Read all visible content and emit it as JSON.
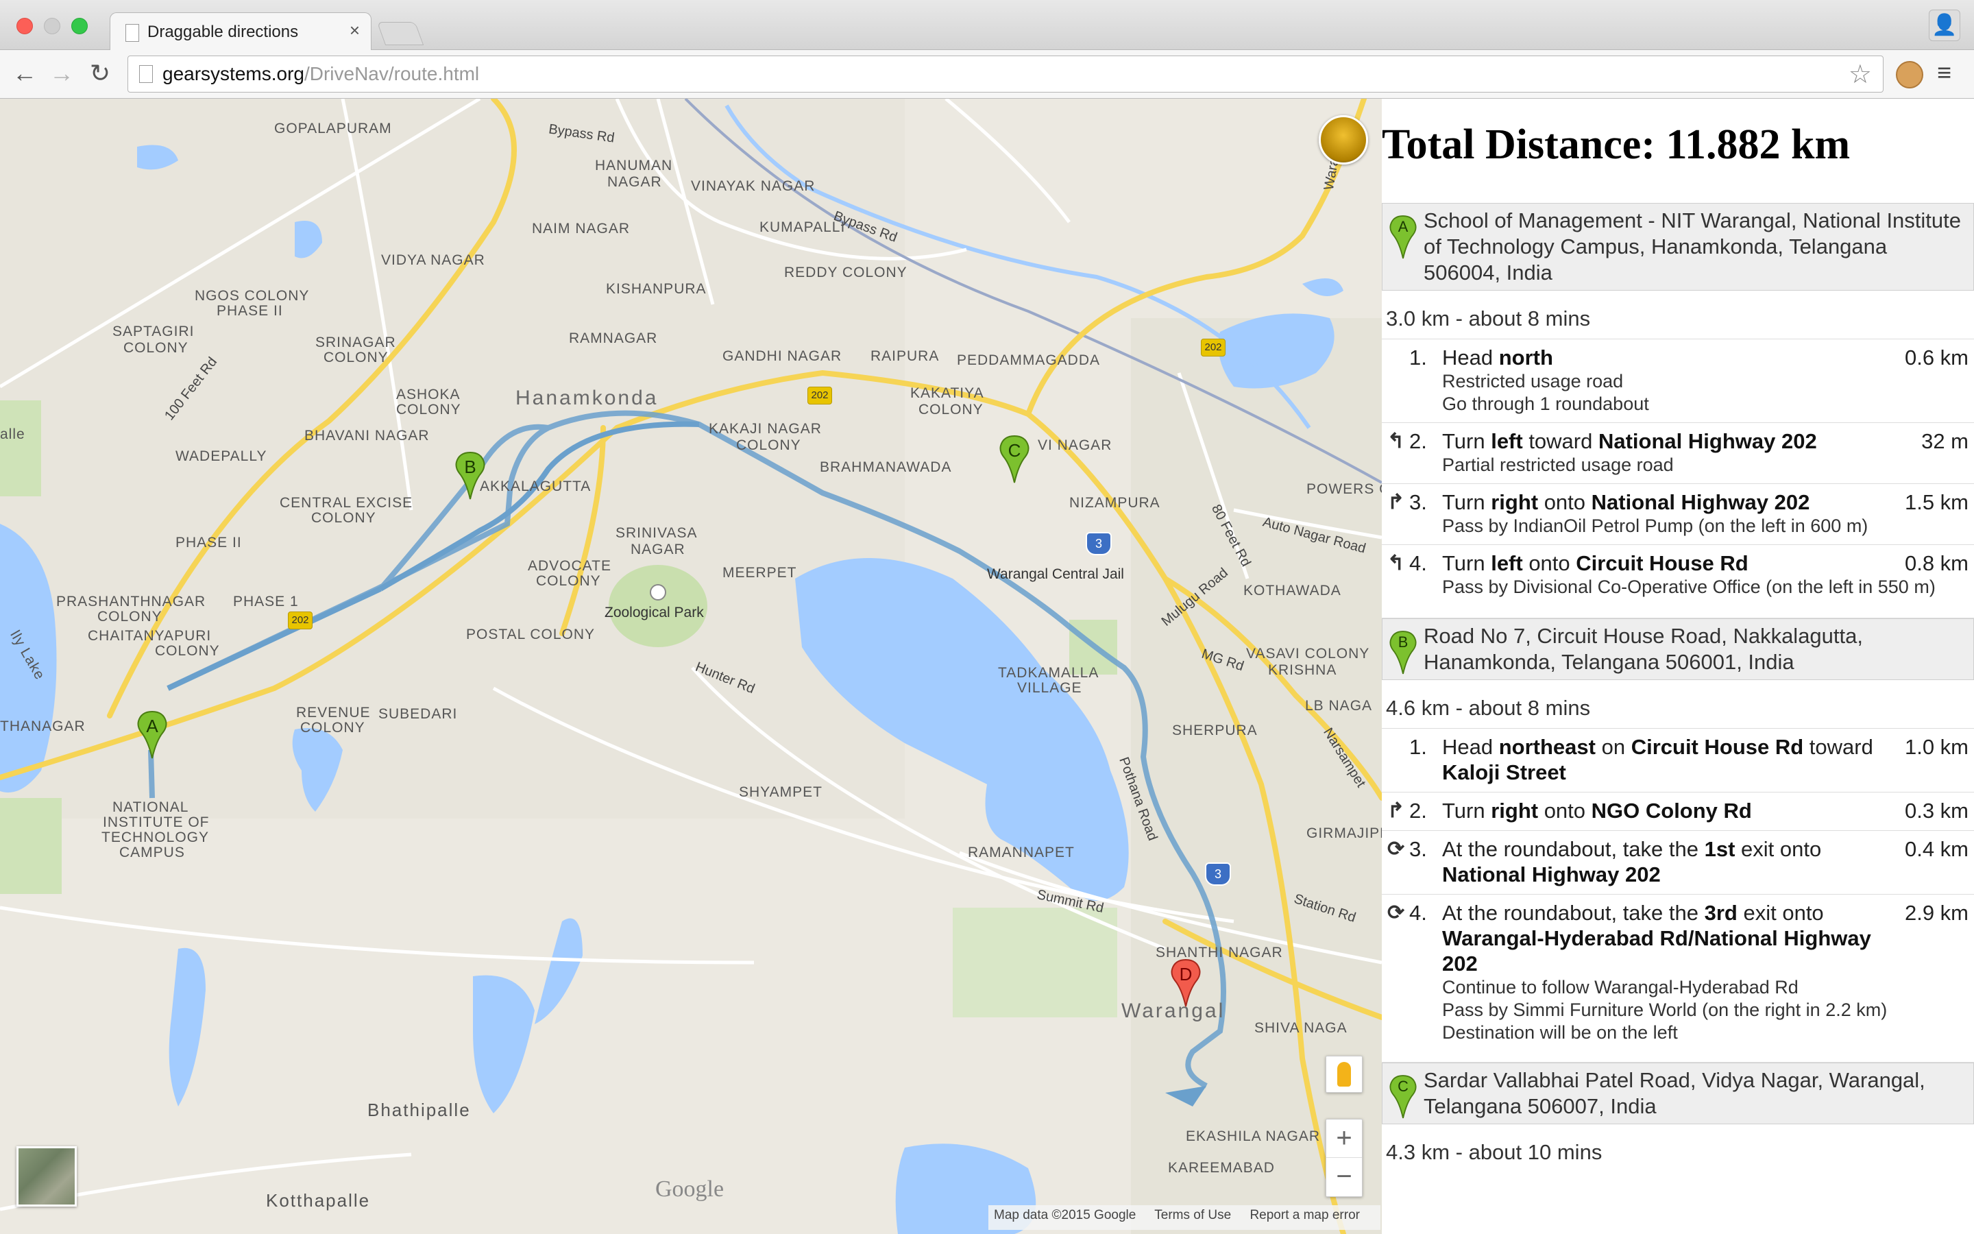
{
  "browser": {
    "tab_title": "Draggable directions",
    "tab_close": "×",
    "url_host": "gearsystems.org",
    "url_path": "/DriveNav/route.html",
    "star": "☆",
    "back": "←",
    "forward": "→",
    "reload": "↻",
    "menu": "≡"
  },
  "map": {
    "labels": {
      "gopalapuram": "GOPALAPURAM",
      "bypass_rd_1": "Bypass Rd",
      "bypass_rd_2": "Bypass Rd",
      "hanuman_nagar_1": "HANUMAN",
      "hanuman_nagar_2": "NAGAR",
      "vinayak_nagar": "VINAYAK NAGAR",
      "naim_nagar": "NAIM NAGAR",
      "kumapalli": "KUMAPALLI",
      "vidya_nagar": "VIDYA NAGAR",
      "reddy_colony": "REDDY COLONY",
      "ngos_colony_1": "NGOS COLONY",
      "ngos_colony_2": "PHASE II",
      "kishanpura": "KISHANPURA",
      "saptagiri_1": "SAPTAGIRI",
      "saptagiri_2": "COLONY",
      "srinagar_1": "SRINAGAR",
      "srinagar_2": "COLONY",
      "ramnagar": "RAMNAGAR",
      "gandhi_nagar": "GANDHI NAGAR",
      "raipura": "RAIPURA",
      "peddammagadda": "PEDDAMMAGADDA",
      "hundred_feet": "100 Feet Rd",
      "ashoka_1": "ASHOKA",
      "ashoka_2": "COLONY",
      "hanamkonda": "Hanamkonda",
      "kakatiya_1": "KAKATIYA",
      "kakatiya_2": "COLONY",
      "bhavani_nagar": "BHAVANI NAGAR",
      "kakaji_1": "KAKAJI NAGAR",
      "kakaji_2": "COLONY",
      "alle": "alle",
      "wadepally": "WADEPALLY",
      "nakkalagutta": "AKKALAGUTTA",
      "brahmanawada": "BRAHMANAWADA",
      "vi_nagar": "VI NAGAR",
      "powers_colony": "POWERS COLO",
      "central_excise_1": "CENTRAL EXCISE",
      "central_excise_2": "COLONY",
      "nizampura": "NIZAMPURA",
      "eighty_feet": "80 Feet Rd",
      "auto_nagar": "Auto Nagar Road",
      "phase2": "PHASE II",
      "srinivasa_1": "SRINIVASA",
      "srinivasa_2": "NAGAR",
      "advocate_1": "ADVOCATE",
      "advocate_2": "COLONY",
      "warangal_central_jail": "Warangal Central Jail",
      "mulugu_road": "Mulugu Road",
      "kothawada": "KOTHAWADA",
      "meerpet": "MEERPET",
      "prashanthnagar_1": "PRASHANTHNAGAR",
      "prashanthnagar_2": "COLONY",
      "phase1": "PHASE 1",
      "zoological_park": "Zoological Park",
      "chaitanyapuri_1": "CHAITANYAPURI",
      "chaitanyapuri_2": "COLONY",
      "postal_colony": "POSTAL COLONY",
      "ly_lake": "lly Lake",
      "mg_rd": "MG Rd",
      "vasavi_colony": "VASAVI COLONY",
      "krishna": "KRISHNA",
      "hunter_rd": "Hunter Rd",
      "tadkamalla_1": "TADKAMALLA",
      "tadkamalla_2": "VILLAGE",
      "thanagar": "THANAGAR",
      "revenue_1": "REVENUE",
      "revenue_2": "COLONY",
      "subedari": "SUBEDARI",
      "lb_nagar": "LB NAGA",
      "sherpura": "SHERPURA",
      "narsampet": "Narsampet",
      "national_1": "NATIONAL",
      "national_2": "INSTITUTE OF",
      "national_3": "TECHNOLOGY",
      "national_4": "CAMPUS",
      "shyampet": "SHYAMPET",
      "pothana_road": "Pothana Road",
      "girmajipet": "GIRMAJIPE",
      "ramannapet": "RAMANNAPET",
      "summit_rd": "Summit Rd",
      "station_rd": "Station Rd",
      "shanthi_nagar": "SHANTHI NAGAR",
      "warangal": "Warangal",
      "shiva_nagar": "SHIVA NAGA",
      "bhathipalle": "Bhathipalle",
      "ekashila_nagar": "EKASHILA NAGAR",
      "kareemabad": "KAREEMABAD",
      "kotthapalle": "Kotthapalle",
      "warangal_rd": "Warangal"
    },
    "shields": {
      "nh202_a": "202",
      "nh202_b": "202",
      "nh202_c": "202",
      "nh3_a": "3",
      "nh3_b": "3"
    },
    "markers": {
      "a": "A",
      "b": "B",
      "c": "C",
      "d": "D"
    },
    "google_logo": "Google",
    "zoom_in": "+",
    "zoom_out": "−",
    "attribution": {
      "map_data": "Map data ©2015 Google",
      "terms": "Terms of Use",
      "report": "Report a map error"
    }
  },
  "directions": {
    "total": "Total Distance: 11.882 km",
    "waypoints": [
      {
        "letter": "A",
        "address": "School of Management - NIT Warangal, National Institute of Technology Campus, Hanamkonda, Telangana 506004, India"
      },
      {
        "letter": "B",
        "address": "Road No 7, Circuit House Road, Nakkalagutta, Hanamkonda, Telangana 506001, India"
      },
      {
        "letter": "C",
        "address": "Sardar Vallabhai Patel Road, Vidya Nagar, Warangal, Telangana 506007, India"
      }
    ],
    "legs": [
      {
        "summary": "3.0 km - about 8 mins",
        "steps": [
          {
            "num": "1.",
            "icon": "",
            "pre": "Head ",
            "b1": "north",
            "mid": "",
            "b2": "",
            "post": "",
            "dist": "0.6 km",
            "notes": [
              "Restricted usage road",
              "Go through 1 roundabout"
            ]
          },
          {
            "num": "2.",
            "icon": "↰",
            "pre": "Turn ",
            "b1": "left",
            "mid": " toward ",
            "b2": "National Highway 202",
            "post": "",
            "dist": "32 m",
            "notes": [
              "Partial restricted usage road"
            ]
          },
          {
            "num": "3.",
            "icon": "↱",
            "pre": "Turn ",
            "b1": "right",
            "mid": " onto ",
            "b2": "National Highway 202",
            "post": "",
            "dist": "1.5 km",
            "notes": [
              "Pass by IndianOil Petrol Pump (on the left in 600 m)"
            ]
          },
          {
            "num": "4.",
            "icon": "↰",
            "pre": "Turn ",
            "b1": "left",
            "mid": " onto ",
            "b2": "Circuit House Rd",
            "post": "",
            "dist": "0.8 km",
            "notes": [
              "Pass by Divisional Co-Operative Office (on the left in 550 m)"
            ]
          }
        ]
      },
      {
        "summary": "4.6 km - about 8 mins",
        "steps": [
          {
            "num": "1.",
            "icon": "",
            "pre": "Head ",
            "b1": "northeast",
            "mid": " on ",
            "b2": "Circuit House Rd",
            "post": " toward ",
            "b3": "Kaloji Street",
            "dist": "1.0 km",
            "notes": []
          },
          {
            "num": "2.",
            "icon": "↱",
            "pre": "Turn ",
            "b1": "right",
            "mid": " onto ",
            "b2": "NGO Colony Rd",
            "post": "",
            "dist": "0.3 km",
            "notes": []
          },
          {
            "num": "3.",
            "icon": "⟳",
            "pre": "At the roundabout, take the ",
            "b1": "1st",
            "mid": " exit onto ",
            "b2": "National Highway 202",
            "post": "",
            "dist": "0.4 km",
            "notes": []
          },
          {
            "num": "4.",
            "icon": "⟳",
            "pre": "At the roundabout, take the ",
            "b1": "3rd",
            "mid": " exit onto ",
            "b2": "Warangal-Hyderabad Rd/National Highway 202",
            "post": "",
            "dist": "2.9 km",
            "notes": [
              "Continue to follow Warangal-Hyderabad Rd",
              "Pass by Simmi Furniture World (on the right in 2.2 km)",
              "Destination will be on the left"
            ]
          }
        ]
      }
    ],
    "leg3_summary": "4.3 km - about 10 mins"
  }
}
